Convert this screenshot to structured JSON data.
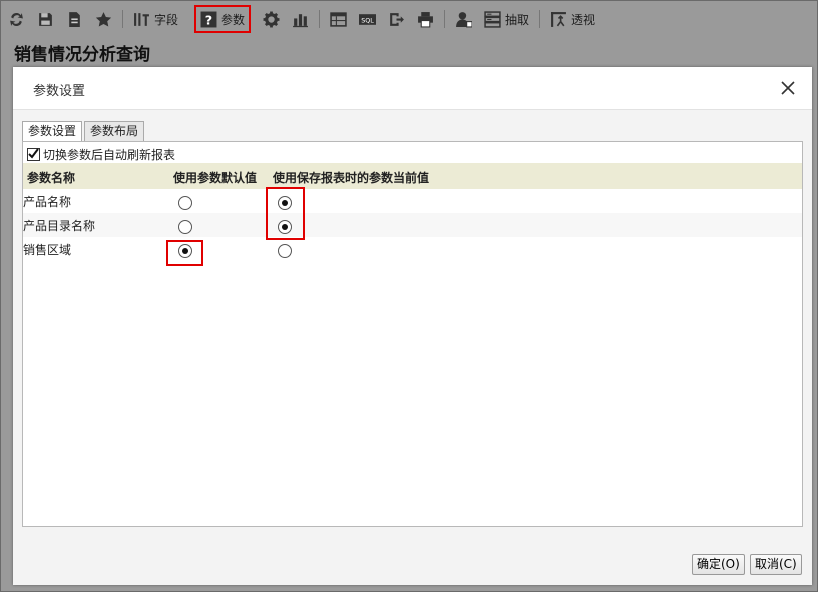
{
  "toolbar": {
    "fields_label": "字段",
    "params_label": "参数",
    "extract_label": "抽取",
    "pivot_label": "透视"
  },
  "page": {
    "title": "销售情况分析查询"
  },
  "dialog": {
    "title": "参数设置",
    "tabs": [
      "参数设置",
      "参数布局"
    ],
    "auto_refresh_label": "切换参数后自动刷新报表",
    "auto_refresh_checked": true,
    "columns": [
      "参数名称",
      "使用参数默认值",
      "使用保存报表时的参数当前值"
    ],
    "rows": [
      {
        "name": "产品名称",
        "selected": "current"
      },
      {
        "name": "产品目录名称",
        "selected": "current"
      },
      {
        "name": "销售区域",
        "selected": "default"
      }
    ],
    "ok_label": "确定(O)",
    "cancel_label": "取消(C)"
  },
  "colors": {
    "highlight": "#e00000",
    "header_row": "#ecebd5"
  }
}
